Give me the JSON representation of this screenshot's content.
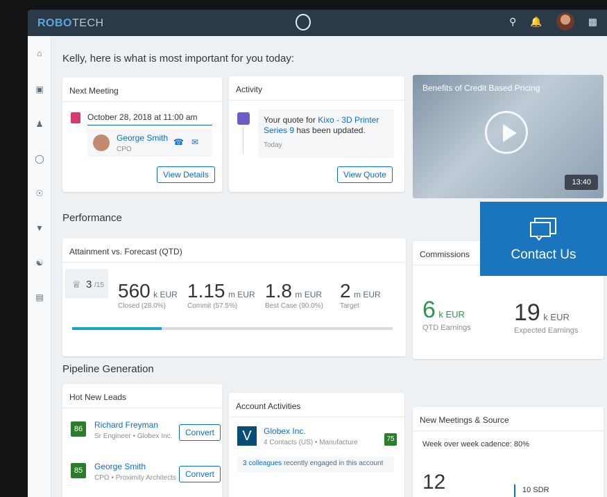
{
  "topbar": {
    "brand_a": "ROBO",
    "brand_b": "TECH"
  },
  "greeting": "Kelly, here is what is most important for you today:",
  "next_meeting": {
    "title": "Next Meeting",
    "when": "October 28, 2018 at 11:00 am",
    "person_name": "George Smith",
    "person_role": "CPO",
    "button": "View Details"
  },
  "activity": {
    "title": "Activity",
    "text_prefix": "Your quote for",
    "link": "Kixo - 3D Printer Series 9",
    "text_suffix": "has been updated.",
    "time": "Today",
    "button": "View Quote"
  },
  "video": {
    "title": "Benefits of Credit Based Pricing",
    "duration": "13:40"
  },
  "contact": {
    "label": "Contact Us"
  },
  "performance": {
    "section": "Performance",
    "title": "Attainment vs. Forecast (QTD)",
    "rank": "3",
    "rank_of": "/15",
    "metrics": [
      {
        "value": "560",
        "unit": "k EUR",
        "label": "Closed (28.0%)"
      },
      {
        "value": "1.15",
        "unit": "m EUR",
        "label": "Commit (57.5%)"
      },
      {
        "value": "1.8",
        "unit": "m EUR",
        "label": "Best Case (90.0%)"
      },
      {
        "value": "2",
        "unit": "m EUR",
        "label": "Target"
      }
    ],
    "progress_fraction": 0.28
  },
  "commissions": {
    "title": "Commissions",
    "earned_value": "6",
    "earned_unit": "k EUR",
    "earned_label": "QTD Earnings",
    "expected_value": "19",
    "expected_unit": "k EUR",
    "expected_label": "Expected Earnings"
  },
  "pipeline": {
    "section": "Pipeline Generation",
    "hot_leads": {
      "title": "Hot New Leads",
      "leads": [
        {
          "score": "86",
          "name": "Richard Freyman",
          "role": "Sr Engineer • Globex Inc.",
          "button": "Convert"
        },
        {
          "score": "85",
          "name": "George Smith",
          "role": "CPO • Proximity Architects",
          "button": "Convert"
        }
      ]
    },
    "account_activities": {
      "title": "Account Activities",
      "company": "Globex Inc.",
      "details": "4 Contacts (US) • Manufacture",
      "score": "75",
      "engaged_link": "3 colleagues",
      "engaged_suffix": "recently engaged in this account"
    },
    "meetings": {
      "title": "New Meetings & Source",
      "cadence": "Week over week cadence: 80%",
      "count": "12",
      "source": "10 SDR"
    }
  },
  "colors": {
    "topbar": "#2b3a49",
    "accent": "#0a6ed1",
    "contact": "#1b75bc",
    "positive": "#2b7d2b"
  }
}
